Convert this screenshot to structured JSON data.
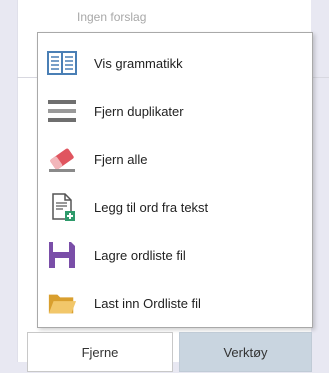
{
  "suggestions_placeholder": "Ingen forslag",
  "menu": {
    "items": [
      {
        "label": "Vis grammatikk",
        "icon": "book-icon"
      },
      {
        "label": "Fjern duplikater",
        "icon": "remove-duplicates-icon"
      },
      {
        "label": "Fjern alle",
        "icon": "eraser-icon"
      },
      {
        "label": "Legg til ord fra tekst",
        "icon": "add-from-text-icon"
      },
      {
        "label": "Lagre ordliste fil",
        "icon": "save-floppy-icon"
      },
      {
        "label": "Last inn Ordliste fil",
        "icon": "folder-open-icon"
      }
    ]
  },
  "buttons": {
    "remove_label": "Fjerne",
    "tools_label": "Verktøy"
  },
  "colors": {
    "background": "#e8e8f2",
    "tools_button_bg": "#c9d5e0",
    "book_icon": "#4a7fb5",
    "eraser_icon": "#e0555f",
    "add_icon": "#2e9a6b",
    "floppy_icon": "#7a4ea8",
    "folder_icon": "#e7b54a"
  }
}
